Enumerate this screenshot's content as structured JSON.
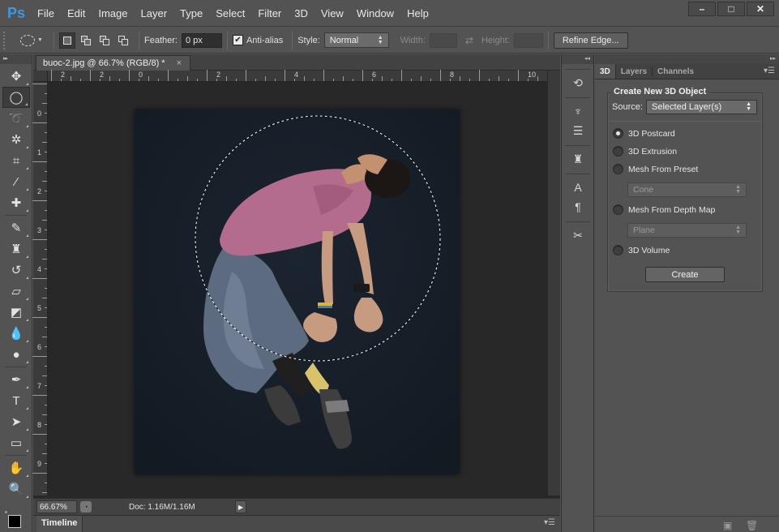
{
  "app": {
    "logo": "Ps"
  },
  "menu": [
    "File",
    "Edit",
    "Image",
    "Layer",
    "Type",
    "Select",
    "Filter",
    "3D",
    "View",
    "Window",
    "Help"
  ],
  "window_controls": {
    "minimize": "–",
    "maximize": "□",
    "close": "✕"
  },
  "options_bar": {
    "feather_label": "Feather:",
    "feather_value": "0 px",
    "antialias_label": "Anti-alias",
    "antialias_checked": true,
    "style_label": "Style:",
    "style_value": "Normal",
    "width_label": "Width:",
    "height_label": "Height:",
    "refine_edge_label": "Refine Edge..."
  },
  "tools": [
    {
      "name": "move-tool",
      "glyph": "✥"
    },
    {
      "name": "elliptical-marquee-tool",
      "glyph": "◯",
      "active": true
    },
    {
      "name": "lasso-tool",
      "glyph": "➰"
    },
    {
      "name": "magic-wand-tool",
      "glyph": "✲"
    },
    {
      "name": "crop-tool",
      "glyph": "⌗"
    },
    {
      "name": "eyedropper-tool",
      "glyph": "⁄"
    },
    {
      "name": "spot-healing-brush-tool",
      "glyph": "✚"
    },
    {
      "name": "brush-tool",
      "glyph": "✎"
    },
    {
      "name": "clone-stamp-tool",
      "glyph": "♜"
    },
    {
      "name": "history-brush-tool",
      "glyph": "↺"
    },
    {
      "name": "eraser-tool",
      "glyph": "▱"
    },
    {
      "name": "paint-bucket-tool",
      "glyph": "◩"
    },
    {
      "name": "blur-tool",
      "glyph": "💧"
    },
    {
      "name": "dodge-tool",
      "glyph": "●"
    },
    {
      "name": "pen-tool",
      "glyph": "✒"
    },
    {
      "name": "type-tool",
      "glyph": "T"
    },
    {
      "name": "path-selection-tool",
      "glyph": "➤"
    },
    {
      "name": "rectangle-tool",
      "glyph": "▭"
    },
    {
      "name": "hand-tool",
      "glyph": "✋"
    },
    {
      "name": "zoom-tool",
      "glyph": "🔍"
    }
  ],
  "document": {
    "tab_title": "buoc-2.jpg @ 66.7% (RGB/8) *",
    "tab_close": "×",
    "ruler_h_labels": [
      "2",
      "2",
      "0",
      "2",
      "4",
      "6",
      "8",
      "10"
    ],
    "ruler_v_labels": [
      "0",
      "1",
      "2",
      "3",
      "4",
      "5",
      "6",
      "7",
      "8",
      "9"
    ],
    "zoom": "66.67%",
    "doc_info": "Doc: 1.16M/1.16M"
  },
  "timeline": {
    "label": "Timeline"
  },
  "panel": {
    "tabs": [
      "3D",
      "Layers",
      "Channels"
    ],
    "active_tab": "3D",
    "group_title": "Create New 3D Object",
    "source_label": "Source:",
    "source_value": "Selected Layer(s)",
    "options": [
      {
        "label": "3D Postcard",
        "selected": true
      },
      {
        "label": "3D Extrusion",
        "selected": false
      },
      {
        "label": "Mesh From Preset",
        "selected": false
      },
      {
        "label": "Mesh From Depth Map",
        "selected": false
      },
      {
        "label": "3D Volume",
        "selected": false
      }
    ],
    "preset_value": "Cone",
    "depth_map_value": "Plane",
    "create_label": "Create"
  },
  "colors": {
    "background": "#535353",
    "canvas": "#161e28",
    "ps_blue": "#3d97e0",
    "shirt": "#b46c8c"
  }
}
